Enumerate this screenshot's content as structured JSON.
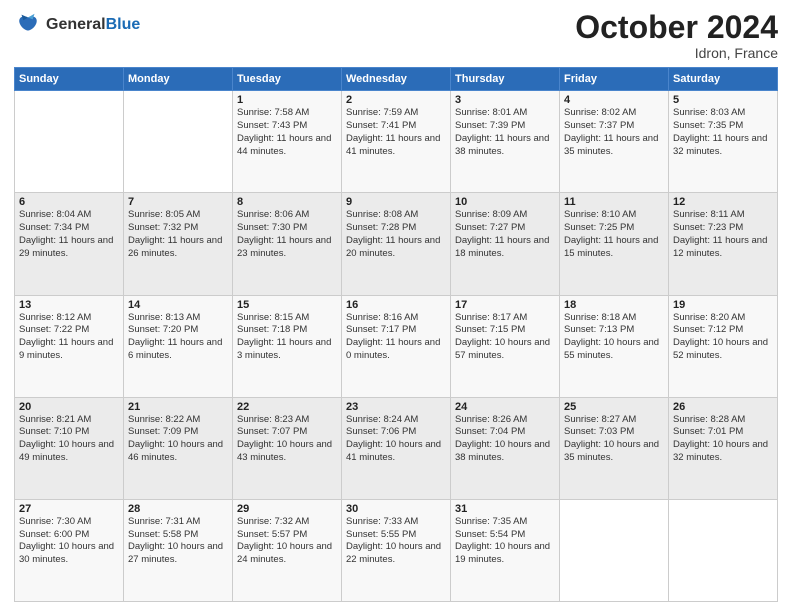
{
  "header": {
    "logo_general": "General",
    "logo_blue": "Blue",
    "month_title": "October 2024",
    "location": "Idron, France"
  },
  "calendar": {
    "days_of_week": [
      "Sunday",
      "Monday",
      "Tuesday",
      "Wednesday",
      "Thursday",
      "Friday",
      "Saturday"
    ],
    "weeks": [
      [
        {
          "day": "",
          "info": ""
        },
        {
          "day": "",
          "info": ""
        },
        {
          "day": "1",
          "info": "Sunrise: 7:58 AM\nSunset: 7:43 PM\nDaylight: 11 hours and 44 minutes."
        },
        {
          "day": "2",
          "info": "Sunrise: 7:59 AM\nSunset: 7:41 PM\nDaylight: 11 hours and 41 minutes."
        },
        {
          "day": "3",
          "info": "Sunrise: 8:01 AM\nSunset: 7:39 PM\nDaylight: 11 hours and 38 minutes."
        },
        {
          "day": "4",
          "info": "Sunrise: 8:02 AM\nSunset: 7:37 PM\nDaylight: 11 hours and 35 minutes."
        },
        {
          "day": "5",
          "info": "Sunrise: 8:03 AM\nSunset: 7:35 PM\nDaylight: 11 hours and 32 minutes."
        }
      ],
      [
        {
          "day": "6",
          "info": "Sunrise: 8:04 AM\nSunset: 7:34 PM\nDaylight: 11 hours and 29 minutes."
        },
        {
          "day": "7",
          "info": "Sunrise: 8:05 AM\nSunset: 7:32 PM\nDaylight: 11 hours and 26 minutes."
        },
        {
          "day": "8",
          "info": "Sunrise: 8:06 AM\nSunset: 7:30 PM\nDaylight: 11 hours and 23 minutes."
        },
        {
          "day": "9",
          "info": "Sunrise: 8:08 AM\nSunset: 7:28 PM\nDaylight: 11 hours and 20 minutes."
        },
        {
          "day": "10",
          "info": "Sunrise: 8:09 AM\nSunset: 7:27 PM\nDaylight: 11 hours and 18 minutes."
        },
        {
          "day": "11",
          "info": "Sunrise: 8:10 AM\nSunset: 7:25 PM\nDaylight: 11 hours and 15 minutes."
        },
        {
          "day": "12",
          "info": "Sunrise: 8:11 AM\nSunset: 7:23 PM\nDaylight: 11 hours and 12 minutes."
        }
      ],
      [
        {
          "day": "13",
          "info": "Sunrise: 8:12 AM\nSunset: 7:22 PM\nDaylight: 11 hours and 9 minutes."
        },
        {
          "day": "14",
          "info": "Sunrise: 8:13 AM\nSunset: 7:20 PM\nDaylight: 11 hours and 6 minutes."
        },
        {
          "day": "15",
          "info": "Sunrise: 8:15 AM\nSunset: 7:18 PM\nDaylight: 11 hours and 3 minutes."
        },
        {
          "day": "16",
          "info": "Sunrise: 8:16 AM\nSunset: 7:17 PM\nDaylight: 11 hours and 0 minutes."
        },
        {
          "day": "17",
          "info": "Sunrise: 8:17 AM\nSunset: 7:15 PM\nDaylight: 10 hours and 57 minutes."
        },
        {
          "day": "18",
          "info": "Sunrise: 8:18 AM\nSunset: 7:13 PM\nDaylight: 10 hours and 55 minutes."
        },
        {
          "day": "19",
          "info": "Sunrise: 8:20 AM\nSunset: 7:12 PM\nDaylight: 10 hours and 52 minutes."
        }
      ],
      [
        {
          "day": "20",
          "info": "Sunrise: 8:21 AM\nSunset: 7:10 PM\nDaylight: 10 hours and 49 minutes."
        },
        {
          "day": "21",
          "info": "Sunrise: 8:22 AM\nSunset: 7:09 PM\nDaylight: 10 hours and 46 minutes."
        },
        {
          "day": "22",
          "info": "Sunrise: 8:23 AM\nSunset: 7:07 PM\nDaylight: 10 hours and 43 minutes."
        },
        {
          "day": "23",
          "info": "Sunrise: 8:24 AM\nSunset: 7:06 PM\nDaylight: 10 hours and 41 minutes."
        },
        {
          "day": "24",
          "info": "Sunrise: 8:26 AM\nSunset: 7:04 PM\nDaylight: 10 hours and 38 minutes."
        },
        {
          "day": "25",
          "info": "Sunrise: 8:27 AM\nSunset: 7:03 PM\nDaylight: 10 hours and 35 minutes."
        },
        {
          "day": "26",
          "info": "Sunrise: 8:28 AM\nSunset: 7:01 PM\nDaylight: 10 hours and 32 minutes."
        }
      ],
      [
        {
          "day": "27",
          "info": "Sunrise: 7:30 AM\nSunset: 6:00 PM\nDaylight: 10 hours and 30 minutes."
        },
        {
          "day": "28",
          "info": "Sunrise: 7:31 AM\nSunset: 5:58 PM\nDaylight: 10 hours and 27 minutes."
        },
        {
          "day": "29",
          "info": "Sunrise: 7:32 AM\nSunset: 5:57 PM\nDaylight: 10 hours and 24 minutes."
        },
        {
          "day": "30",
          "info": "Sunrise: 7:33 AM\nSunset: 5:55 PM\nDaylight: 10 hours and 22 minutes."
        },
        {
          "day": "31",
          "info": "Sunrise: 7:35 AM\nSunset: 5:54 PM\nDaylight: 10 hours and 19 minutes."
        },
        {
          "day": "",
          "info": ""
        },
        {
          "day": "",
          "info": ""
        }
      ]
    ]
  }
}
